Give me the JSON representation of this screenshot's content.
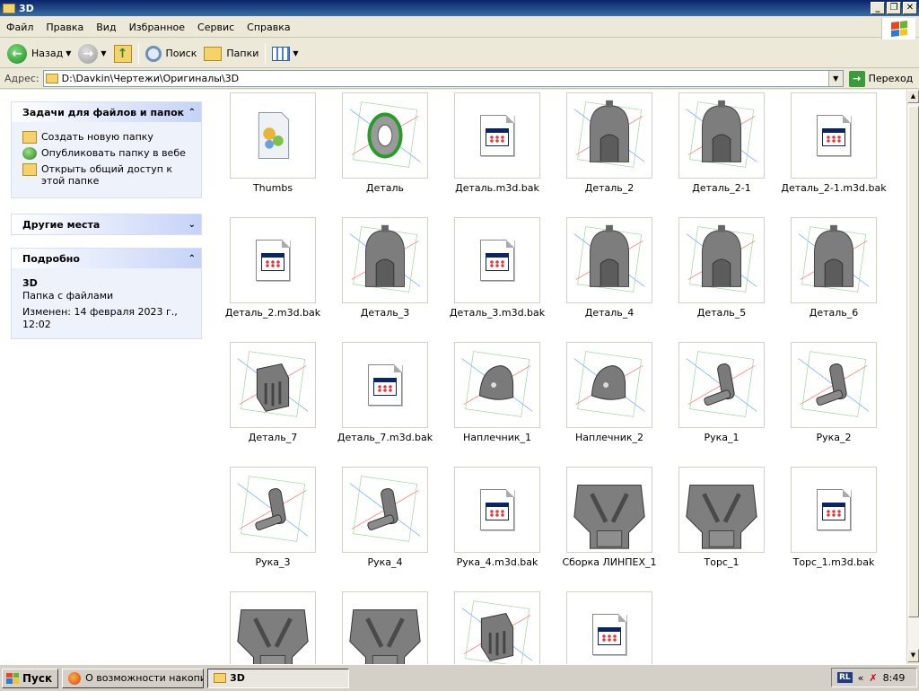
{
  "window": {
    "title": "3D"
  },
  "menu": [
    "Файл",
    "Правка",
    "Вид",
    "Избранное",
    "Сервис",
    "Справка"
  ],
  "toolbar": {
    "back": "Назад",
    "search": "Поиск",
    "folders": "Папки"
  },
  "address": {
    "label": "Адрес:",
    "path": "D:\\Davkin\\Чертежи\\Оригиналы\\3D",
    "go": "Переход"
  },
  "tasks_panel": {
    "title": "Задачи для файлов и папок",
    "items": [
      "Создать новую папку",
      "Опубликовать папку в вебе",
      "Открыть общий доступ к этой папке"
    ]
  },
  "places_panel": {
    "title": "Другие места"
  },
  "details_panel": {
    "title": "Подробно",
    "name": "3D",
    "type": "Папка с файлами",
    "modified": "Изменен: 14 февраля 2023 г., 12:02"
  },
  "files": [
    {
      "name": "Thumbs",
      "kind": "db"
    },
    {
      "name": "Деталь",
      "kind": "ring"
    },
    {
      "name": "Деталь.m3d.bak",
      "kind": "doc"
    },
    {
      "name": "Деталь_2",
      "kind": "helmet"
    },
    {
      "name": "Деталь_2-1",
      "kind": "helmet"
    },
    {
      "name": "Деталь_2-1.m3d.bak",
      "kind": "doc"
    },
    {
      "name": "Деталь_2.m3d.bak",
      "kind": "doc"
    },
    {
      "name": "Деталь_3",
      "kind": "helmet"
    },
    {
      "name": "Деталь_3.m3d.bak",
      "kind": "doc"
    },
    {
      "name": "Деталь_4",
      "kind": "helmet"
    },
    {
      "name": "Деталь_5",
      "kind": "helmet"
    },
    {
      "name": "Деталь_6",
      "kind": "helmet"
    },
    {
      "name": "Деталь_7",
      "kind": "part"
    },
    {
      "name": "Деталь_7.m3d.bak",
      "kind": "doc"
    },
    {
      "name": "Наплечник_1",
      "kind": "shoulder"
    },
    {
      "name": "Наплечник_2",
      "kind": "shoulder"
    },
    {
      "name": "Рука_1",
      "kind": "arm"
    },
    {
      "name": "Рука_2",
      "kind": "arm"
    },
    {
      "name": "Рука_3",
      "kind": "arm"
    },
    {
      "name": "Рука_4",
      "kind": "arm"
    },
    {
      "name": "Рука_4.m3d.bak",
      "kind": "doc"
    },
    {
      "name": "Сборка ЛИНПЕХ_1",
      "kind": "torso"
    },
    {
      "name": "Торс_1",
      "kind": "torso"
    },
    {
      "name": "Торс_1.m3d.bak",
      "kind": "doc"
    },
    {
      "name": "",
      "kind": "torso"
    },
    {
      "name": "",
      "kind": "torso"
    },
    {
      "name": "",
      "kind": "part"
    },
    {
      "name": "",
      "kind": "doc"
    }
  ],
  "taskbar": {
    "start": "Пуск",
    "tasks": [
      "О возможности накопи...",
      "3D"
    ],
    "lang": "RL",
    "clock": "8:49"
  }
}
